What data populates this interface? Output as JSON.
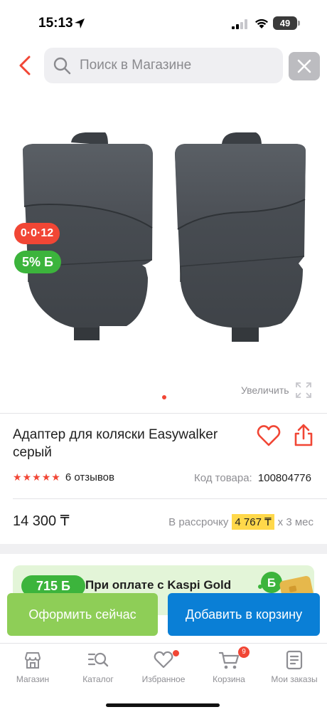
{
  "status_bar": {
    "time": "15:13",
    "battery": "49"
  },
  "search": {
    "placeholder": "Поиск в Магазине"
  },
  "product": {
    "badge_installment": "0·0·12",
    "badge_bonus": "5% Б",
    "zoom_label": "Увеличить",
    "title": "Адаптер для коляски Easywalker серый",
    "rating": 5,
    "reviews": "6 отзывов",
    "sku_label": "Код товара:",
    "sku": "100804776",
    "price": "14 300 ₸",
    "installment_prefix": "В рассрочку",
    "installment_amount": "4 767 ₸",
    "installment_suffix": "х 3 мес"
  },
  "promo": {
    "bonus": "715 Б",
    "text": "При оплате с Kaspi Gold"
  },
  "actions": {
    "order": "Оформить сейчас",
    "add_to_cart": "Добавить в корзину"
  },
  "tabs": [
    {
      "label": "Магазин",
      "icon": "store-icon"
    },
    {
      "label": "Каталог",
      "icon": "catalog-search-icon"
    },
    {
      "label": "Избранное",
      "icon": "heart-icon"
    },
    {
      "label": "Корзина",
      "icon": "cart-icon",
      "count": "9"
    },
    {
      "label": "Мои заказы",
      "icon": "orders-icon"
    }
  ],
  "colors": {
    "accent_red": "#f14635",
    "bonus_green": "#3cb43c",
    "order_green": "#8ece57",
    "cart_blue": "#0a7fd6",
    "installment_yellow": "#ffd84a"
  }
}
